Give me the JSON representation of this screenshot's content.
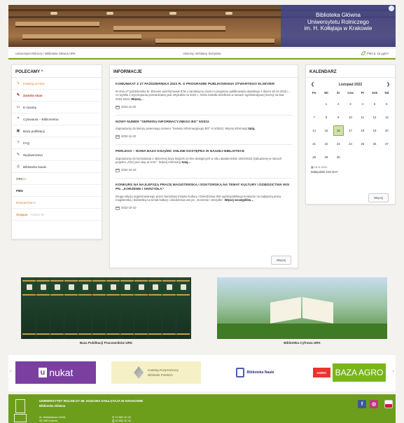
{
  "header": {
    "title_lines": [
      "Biblioteka Główna",
      "Uniwersytetu Rolniczego",
      "im. H. Kołłątaja w Krakowie"
    ]
  },
  "breadcrumb": {
    "path": "Uniwersytet Rolniczy / Biblioteka Główna URK",
    "nameday": "Imieniny: Bohdany, Bożydara",
    "pm": "PM2.5: 15 µg/m³"
  },
  "left": {
    "title": "POLECAMY",
    "items": [
      {
        "label": "Katalog on-line",
        "icon": "↳"
      },
      {
        "label": "Zamów skan",
        "icon": "✎"
      },
      {
        "label": "E-zasoby",
        "icon": "▭"
      },
      {
        "label": "Cytowania – Bibliometria",
        "icon": "❝"
      },
      {
        "label": "Baza publikacji",
        "icon": "▣"
      },
      {
        "label": "FAQ",
        "icon": "?"
      },
      {
        "label": "Wydawnictwo",
        "icon": "✎"
      },
      {
        "label": "Biblioteka Nauki",
        "icon": "◎"
      },
      {
        "label_a": "ORC",
        "label_b": "iD"
      },
      {
        "label": "PBN"
      },
      {
        "label_a": "Researcher",
        "label_b": "ID"
      },
      {
        "label_a": "Scopus",
        "label_b": "Author ID"
      }
    ]
  },
  "news": {
    "title": "INFORMACJE",
    "items": [
      {
        "title": "KOMUNIKAT Z 27 PAŹDZIERNIKA 2022 R. O PROGRAMIE PUBLIKOWANIA OTWARTEGO ELSEVIER",
        "body": "W dniu 27 października br. Elsevier poinformował ICM o zamknięciu części A programu publikowania otwartego z dniem 28.10.2022 r., co wynika z wyczerpania przewidzianej puli artykułów na 2022 r., która została określona w ramach ogólnokrajowej licencji na lata 2022-2024.",
        "more": "Więcej…",
        "date": "2022-11-02"
      },
      {
        "title": "NOWY NUMER \"SERWISU INFORMACYJNEGO BG\" 5/2022",
        "body": "Zapraszamy do lektury jesiennego numeru \"Serwisu Informacyjnego BG\" nr 5/2022. Więcej informacji",
        "more": "tutaj.",
        "date": "2022-11-02"
      },
      {
        "title": "PERLEGO – NOWA BAZA KSIĄŻEK ONLINE DOSTĘPNA W NASZEJ BIBLIOTECE",
        "body": "Zapraszamy do korzystania z obszernej bazy książek on-line dostępnych w roku akademickim 2022/2023 (zakupionej w ramach projektu „Find your way at UAK\". Więcej informacji",
        "more": "tutaj…",
        "date": "2022-10-19"
      },
      {
        "title": "KONKURS NA NAJLEPSZĄ PRACĘ MAGISTERSKĄ I DOKTORSKĄ NA TEMAT KULTURY I DZIEDZICTWA WSI PN. „KORZENIE I SKRZYDŁA\"",
        "body": "Druga edycja organizowanego przez Narodowy Instytut Kultury i Dziedzictwa Wsi ogólnopolskiego konkursu na najlepszą pracę magisterską i doktorską na temat kultury i dziedzictwa wsi pn. „Korzenie i skrzydła\".",
        "more": "Więcej szczegółów…",
        "date": "2022-10-10"
      }
    ],
    "more_button": "Więcej"
  },
  "calendar": {
    "title": "KALENDARZ",
    "month": "Listopad 2022",
    "prev": "❮",
    "next": "❯",
    "dows": [
      "Pn",
      "Wt",
      "Śr",
      "Czw",
      "Pt",
      "Sob",
      "Nd"
    ],
    "days": [
      "",
      "1",
      "2",
      "3",
      "4",
      "5",
      "6",
      "7",
      "8",
      "9",
      "10",
      "11",
      "12",
      "13",
      "14",
      "15",
      "16",
      "17",
      "18",
      "19",
      "20",
      "21",
      "22",
      "23",
      "24",
      "25",
      "26",
      "27",
      "28",
      "29",
      "30",
      "",
      "",
      "",
      ""
    ],
    "today": "16",
    "event_date": "16.11.2022",
    "event_title": "Małopolski GIS DAY",
    "more_button": "Więcej"
  },
  "featured": [
    {
      "caption": "Baza Publikacji Pracowników URK"
    },
    {
      "caption": "Biblioteka Cyfrowa URK"
    }
  ],
  "partners": {
    "unukat": "nukat",
    "unukat_box": "u",
    "kbp_line1": "Katalog Rozproszony",
    "kbp_line2": "Bibliotek Polskich",
    "bn": "Biblioteka Nauki",
    "agro_mini": "AGRO",
    "agro": "BAZA AGRO",
    "prev": "‹",
    "next": "›"
  },
  "footer": {
    "university": "UNIWERSYTET ROLNICZY IM. HUGONA KOŁŁĄTAJA W KRAKOWIE",
    "library": "Biblioteka Główna",
    "address1": "Al. Mickiewicza 24/28",
    "address2": "30-059 Kraków",
    "tel1": "12 662 40 32",
    "tel2": "12 662 40 32",
    "fb": "f",
    "ig": "◎"
  }
}
